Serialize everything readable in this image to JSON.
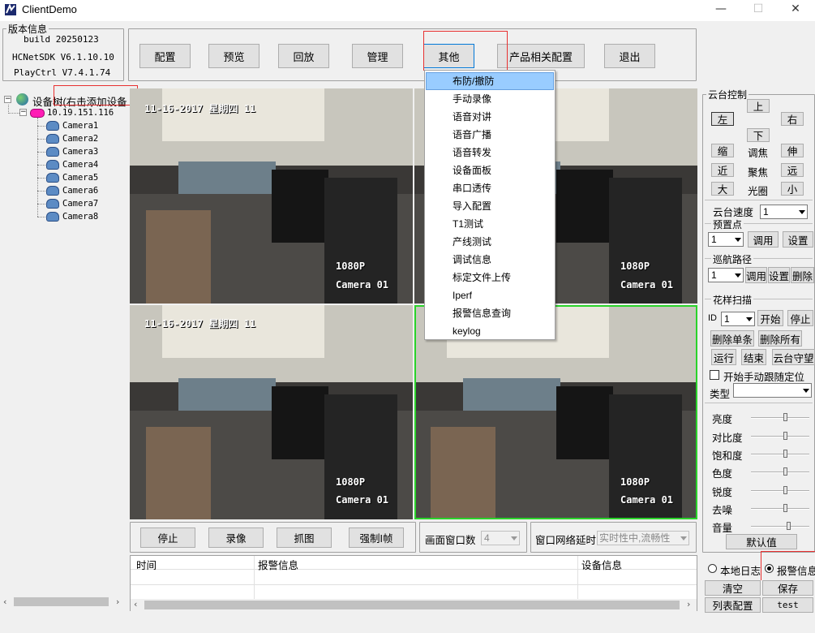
{
  "window": {
    "title": "ClientDemo",
    "min": "—",
    "max": "☐",
    "close": "✕"
  },
  "version": {
    "group": "版本信息",
    "build": "build 20250123",
    "sdk": "HCNetSDK V6.1.10.10",
    "playctrl": "PlayCtrl V7.4.1.74"
  },
  "toolbar": {
    "config": "配置",
    "preview": "预览",
    "playback": "回放",
    "manage": "管理",
    "other": "其他",
    "product_config": "产品相关配置",
    "exit": "退出"
  },
  "tree": {
    "root": "设备树(右击添加设备",
    "device": "10.19.151.116",
    "cameras": [
      "Camera1",
      "Camera2",
      "Camera3",
      "Camera4",
      "Camera5",
      "Camera6",
      "Camera7",
      "Camera8"
    ]
  },
  "video": {
    "timestamp": "11-16-2017 星期四 11",
    "resolution": "1080P",
    "channel": "Camera 01"
  },
  "menu": {
    "items": [
      "布防/撤防",
      "手动录像",
      "语音对讲",
      "语音广播",
      "语音转发",
      "设备面板",
      "串口透传",
      "导入配置",
      "T1测试",
      "产线测试",
      "调试信息",
      "标定文件上传",
      "Iperf",
      "报警信息查询",
      "keylog"
    ],
    "selected": "布防/撤防"
  },
  "controls": {
    "stop": "停止",
    "record": "录像",
    "capture": "抓图",
    "force_i": "强制I帧",
    "window_count_label": "画面窗口数",
    "window_count": "4",
    "delay_label": "窗口网络延时",
    "delay_value": "实时性中,流畅性"
  },
  "ptz": {
    "group": "云台控制",
    "up": "上",
    "down": "下",
    "left": "左",
    "right": "右",
    "zoom_out": "缩",
    "zoom_label": "调焦",
    "zoom_in": "伸",
    "near": "近",
    "focus_label": "聚焦",
    "far": "远",
    "big": "大",
    "iris_label": "光圈",
    "small": "小",
    "speed_label": "云台速度",
    "speed": "1",
    "preset_label": "预置点",
    "preset": "1",
    "call": "调用",
    "set": "设置",
    "cruise_label": "巡航路径",
    "cruise": "1",
    "cruise_call": "调用",
    "cruise_set": "设置",
    "cruise_delete": "删除",
    "pattern_label": "花样扫描",
    "id_label": "ID",
    "pattern_id": "1",
    "start": "开始",
    "stop": "停止",
    "delete_one": "删除单条",
    "delete_all": "删除所有",
    "run": "运行",
    "end": "结束",
    "guard": "云台守望",
    "manual_track": "开始手动跟随定位",
    "type_label": "类型"
  },
  "image": {
    "sliders": [
      {
        "label": "亮度",
        "value": 0.6
      },
      {
        "label": "对比度",
        "value": 0.6
      },
      {
        "label": "饱和度",
        "value": 0.6
      },
      {
        "label": "色度",
        "value": 0.6
      },
      {
        "label": "锐度",
        "value": 0.6
      },
      {
        "label": "去噪",
        "value": 0.6
      },
      {
        "label": "音量",
        "value": 0.65
      }
    ],
    "default": "默认值"
  },
  "log": {
    "columns": [
      "时间",
      "报警信息",
      "设备信息"
    ],
    "local_log": "本地日志",
    "alarm_info": "报警信息",
    "clear": "清空",
    "save": "保存",
    "list_config": "列表配置",
    "test": "test"
  }
}
